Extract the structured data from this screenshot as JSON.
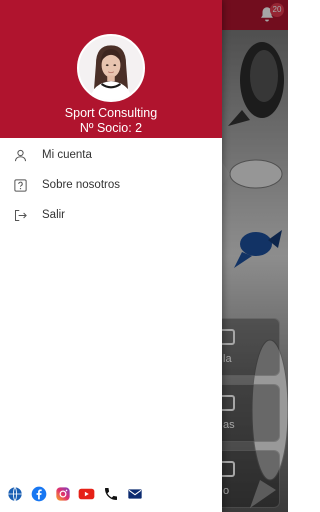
{
  "app": {
    "notification_count": "20",
    "cards": [
      {
        "label": "la"
      },
      {
        "label": "as"
      },
      {
        "label": "o"
      }
    ]
  },
  "drawer": {
    "user_name": "Sport Consulting",
    "member_text": "Nº Socio: 2",
    "menu": [
      {
        "label": "Mi cuenta",
        "icon": "user-icon"
      },
      {
        "label": "Sobre nosotros",
        "icon": "question-icon"
      },
      {
        "label": "Salir",
        "icon": "logout-icon"
      }
    ],
    "social": [
      "globe-icon",
      "facebook-icon",
      "instagram-icon",
      "youtube-icon",
      "phone-icon",
      "mail-icon"
    ]
  },
  "colors": {
    "brand": "#b0142e",
    "drawer_bg": "#ffffff",
    "text": "#333333",
    "facebook": "#1877f2",
    "youtube": "#e62117",
    "globe": "#1a5fb4",
    "mail": "#0b2a6f"
  }
}
